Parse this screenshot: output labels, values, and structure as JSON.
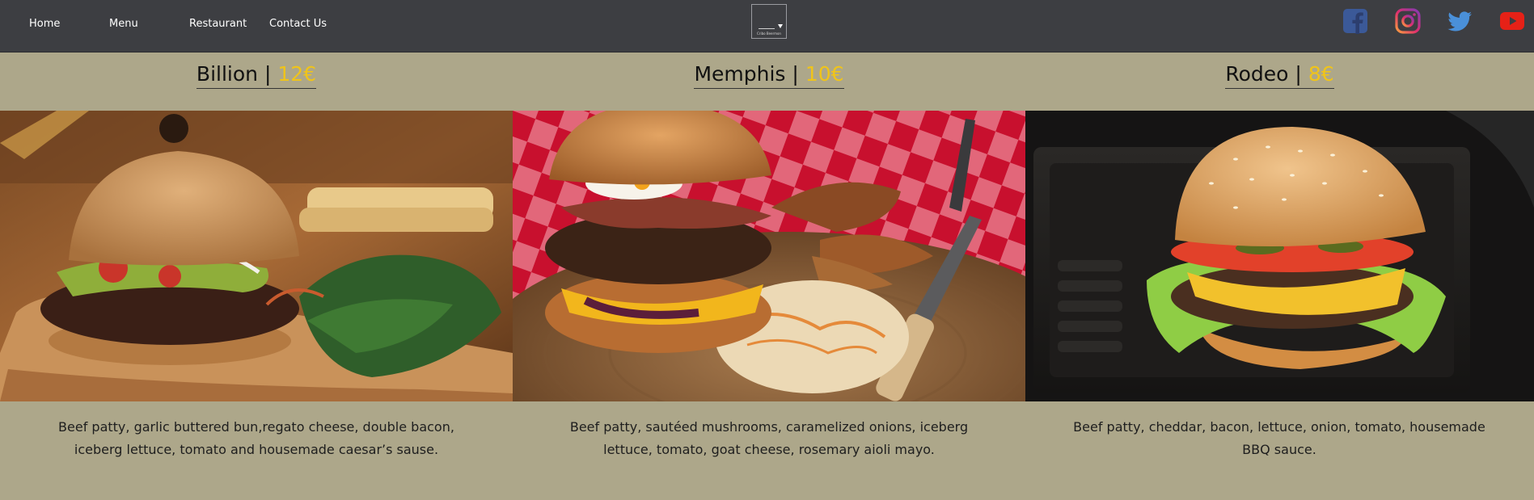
{
  "nav": {
    "links": [
      "Home",
      "Menu",
      "Restaurant",
      "Contact Us"
    ],
    "logo_text": "Cribo Beermon"
  },
  "social": [
    "facebook-icon",
    "instagram-icon",
    "twitter-icon",
    "youtube-icon"
  ],
  "colors": {
    "nav_bg": "#3d3e42",
    "page_bg": "#ada78a",
    "price": "#f0c419",
    "facebook": "#3b5998",
    "twitter": "#4a90d9",
    "youtube": "#e62117"
  },
  "menu": [
    {
      "name": "Billion",
      "price": "12€",
      "description": "Beef patty, garlic buttered bun,regato cheese, double bacon, iceberg lettuce, tomato and housemade caesar’s sause."
    },
    {
      "name": "Memphis",
      "price": "10€",
      "description": "Beef patty, sautéed mushrooms, caramelized onions, iceberg lettuce, tomato, goat cheese, rosemary aioli mayo."
    },
    {
      "name": "Rodeo",
      "price": "8€",
      "description": "Beef patty, cheddar, bacon, lettuce, onion, tomato, housemade BBQ sauce."
    }
  ],
  "separator": "|"
}
